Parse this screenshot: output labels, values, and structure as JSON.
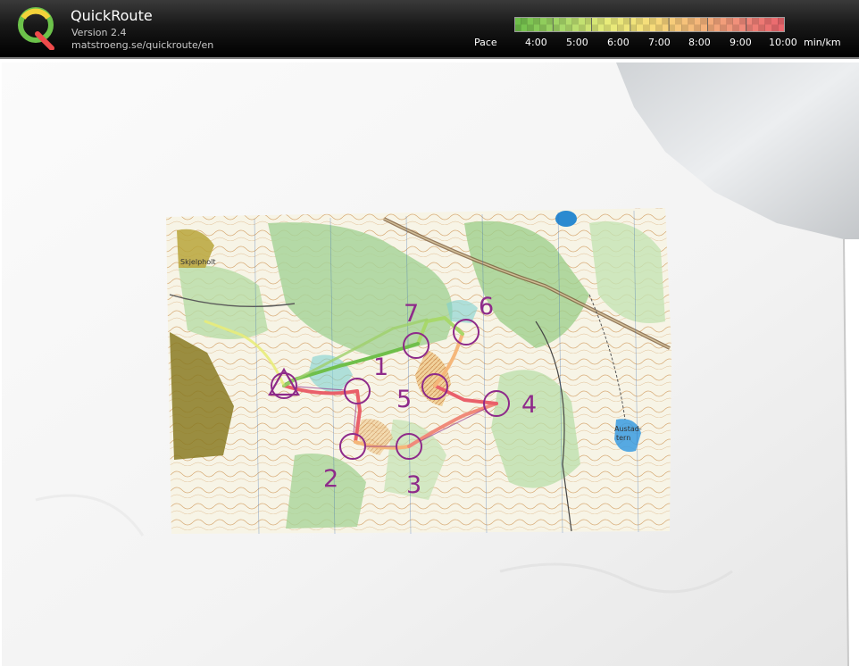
{
  "app": {
    "title": "QuickRoute",
    "version": "Version 2.4",
    "url": "matstroeng.se/quickroute/en"
  },
  "pace_legend": {
    "label": "Pace",
    "ticks": [
      "4:00",
      "5:00",
      "6:00",
      "7:00",
      "8:00",
      "9:00",
      "10:00"
    ],
    "units": "min/km",
    "colors": [
      "#6fbf4a",
      "#a8d86a",
      "#e8ec7a",
      "#f7dc7a",
      "#f5b77a",
      "#f08a7a",
      "#e9606a"
    ]
  },
  "map": {
    "place_labels": [
      "Skjelpholt",
      "Austad-",
      "tern"
    ],
    "controls": [
      {
        "label": "1"
      },
      {
        "label": "2"
      },
      {
        "label": "3"
      },
      {
        "label": "4"
      },
      {
        "label": "5"
      },
      {
        "label": "6"
      },
      {
        "label": "7"
      }
    ],
    "control_color": "#8e2a8a"
  }
}
